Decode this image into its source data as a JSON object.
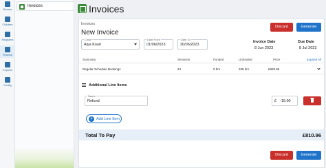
{
  "rail": [
    {
      "label": "Rooms",
      "icon": "rooms-icon"
    },
    {
      "label": "Children",
      "icon": "children-icon"
    },
    {
      "label": "Registers",
      "icon": "registers-icon"
    },
    {
      "label": "Finance",
      "icon": "finance-icon"
    },
    {
      "label": "Exports",
      "icon": "exports-icon"
    },
    {
      "label": "Config",
      "icon": "config-icon"
    }
  ],
  "sidebar": {
    "active_item": "Invoices"
  },
  "page": {
    "title": "Invoices"
  },
  "card": {
    "breadcrumb": "Invoices",
    "heading": "New Invoice",
    "discard_label": "Discard",
    "generate_label": "Generate"
  },
  "form": {
    "child_label": "Child",
    "child_value": "Alya Kouri",
    "date_from_label": "Date From",
    "date_from_value": "01/06/2023",
    "date_to_label": "Date To",
    "date_to_value": "30/06/2023"
  },
  "meta": {
    "invoice_date_label": "Invoice Date",
    "invoice_date_value": "8 Jun 2023",
    "due_date_label": "Due Date",
    "due_date_value": "8 Jul 2023"
  },
  "summary_table": {
    "headers": [
      "Summary",
      "Sessions",
      "Funded",
      "Unfunded",
      "Price"
    ],
    "expand_label": "Expand All",
    "rows": [
      {
        "summary": "Regular Schedule Bookings",
        "sessions": "24",
        "funded": "0 hrs",
        "unfunded": "108 hrs",
        "price": "£825.96"
      }
    ]
  },
  "additional": {
    "title": "Additional Line Items",
    "name_label": "Name",
    "name_value": "Refund",
    "amount_currency": "£",
    "amount_value": "-15.00",
    "add_label": "Add Line Item"
  },
  "total": {
    "label": "Total To Pay",
    "value": "£810.96"
  },
  "colors": {
    "accent": "#1f73c9",
    "danger": "#c9302c",
    "brand": "#3a8a3a"
  }
}
